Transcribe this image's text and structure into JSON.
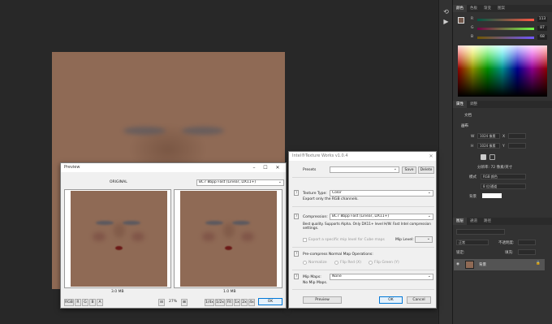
{
  "photoshop": {
    "panel_tabs_color": [
      "颜色",
      "色板",
      "渐变",
      "图案"
    ],
    "channels": [
      {
        "label": "R",
        "value": "113"
      },
      {
        "label": "G",
        "value": "87"
      },
      {
        "label": "B",
        "value": "68"
      }
    ],
    "properties_tabs": [
      "属性",
      "调整"
    ],
    "properties_section": "文档",
    "canvas_heading": "画布",
    "width_label": "W",
    "width_value": "1024 像素",
    "height_label": "H",
    "height_value": "1024 像素",
    "x_label": "X",
    "y_label": "Y",
    "resolution": "分辨率: 72 像素/英寸",
    "mode_label": "模式",
    "mode_value": "RGB 颜色",
    "depth_value": "8 位/通道",
    "background_label": "背景",
    "layers_tabs": [
      "图层",
      "通道",
      "路径"
    ],
    "blend_mode": "正常",
    "opacity_label": "不透明度:",
    "lock_label": "锁定:",
    "fill_label": "填充:",
    "layer_name": "背景",
    "accent": "#8f6a55"
  },
  "preview_window": {
    "title": "Preview",
    "original_label": "ORIGINAL",
    "compression_select": "BC7   8bpp  Fast (Linear, DX11+)",
    "left_size": "3.0 MB",
    "right_size": "1.0 MB",
    "channel_buttons": [
      "RGB",
      "R",
      "G",
      "B",
      "A"
    ],
    "zoom_value": "27%",
    "zoom_buttons": [
      "1/4x",
      "1/2x",
      "Fit",
      "1x",
      "2x",
      "4x"
    ],
    "ok_label": "OK"
  },
  "texture_works": {
    "title": "Intel®Texture Works v1.0.4",
    "presets_label": "Presets",
    "presets_value": "",
    "save_label": "Save",
    "delete_label": "Delete",
    "help_glyph": "?",
    "texture_type_label": "Texture Type:",
    "texture_type_value": "Color",
    "texture_type_desc": "Export only the RGB channels.",
    "compression_label": "Compression:",
    "compression_value": "BC7   8bpp  Fast (Linear, DX11+)",
    "compression_desc_1": "Best quality. Supports Alpha. Only DX11+ level H/W. Fast Intel compression",
    "compression_desc_2": "settings.",
    "export_mip_label": "Export a specific mip level for Cube maps",
    "mip_level_label": "Mip Level:",
    "normal_map_label": "Pre-compress Normal Map Operations:",
    "normal_options": [
      "Normalize",
      "Flip Red (X)",
      "Flip Green (Y)"
    ],
    "mip_maps_label": "Mip Maps:",
    "mip_maps_value": "None",
    "mip_maps_desc": "No Mip Maps.",
    "preview_label": "Preview",
    "ok_label": "OK",
    "cancel_label": "Cancel"
  }
}
